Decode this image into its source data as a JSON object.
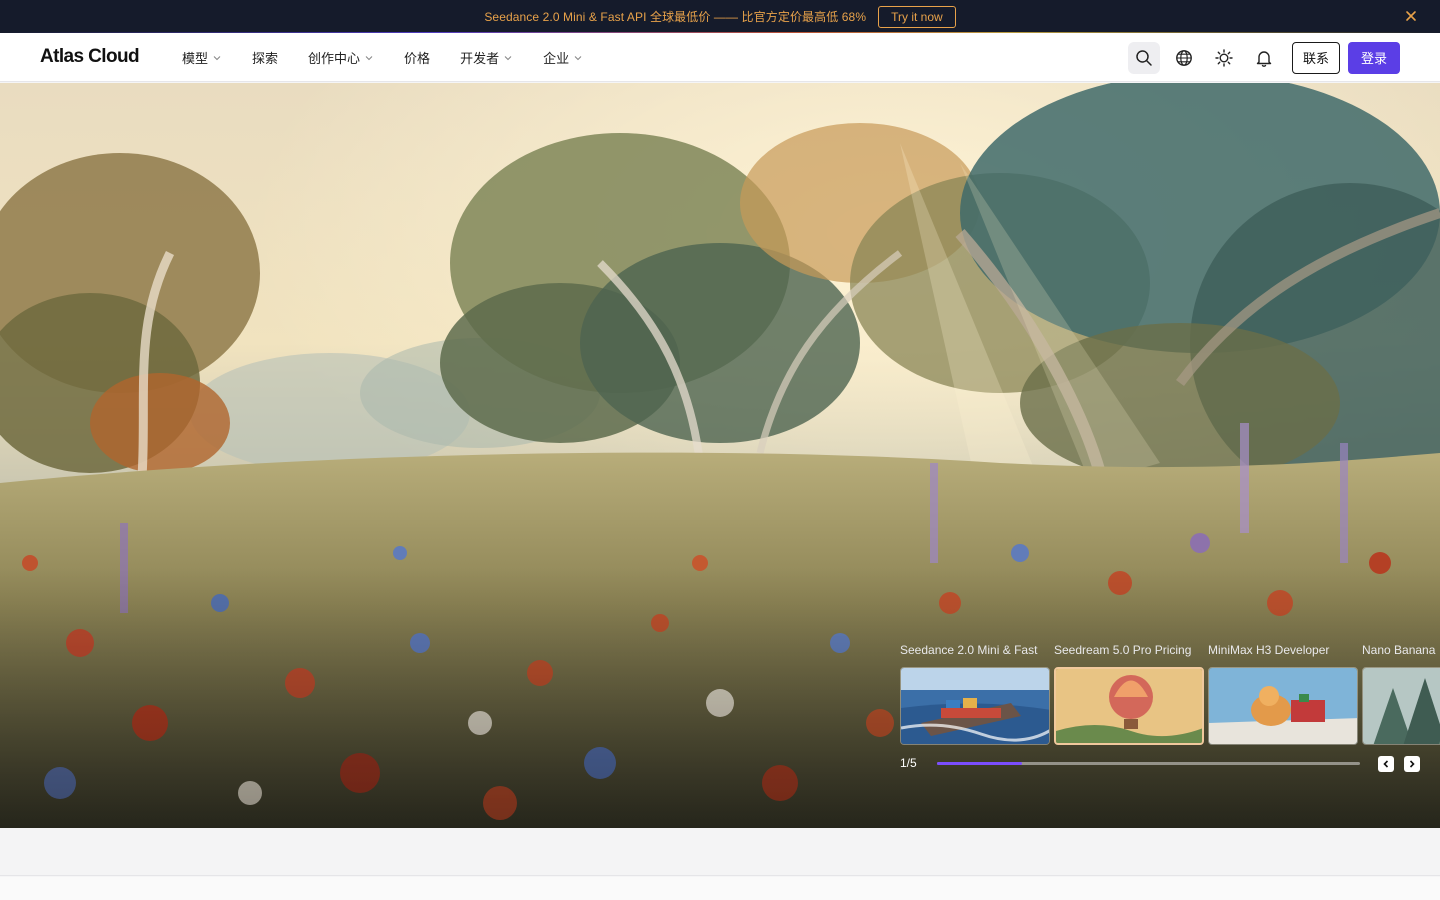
{
  "announcement": {
    "text": "Seedance 2.0 Mini & Fast API 全球最低价 —— 比官方定价最高低 68%",
    "cta_label": "Try it now",
    "accent_color": "#e8a24a",
    "close_icon": "close-icon"
  },
  "nav": {
    "logo": "Atlas Cloud",
    "menu": [
      {
        "label": "模型",
        "has_dropdown": true
      },
      {
        "label": "探索",
        "has_dropdown": false
      },
      {
        "label": "创作中心",
        "has_dropdown": true
      },
      {
        "label": "价格",
        "has_dropdown": false
      },
      {
        "label": "开发者",
        "has_dropdown": true
      },
      {
        "label": "企业",
        "has_dropdown": true
      }
    ],
    "icons": [
      "search-icon",
      "globe-icon",
      "sun-icon",
      "bell-icon"
    ],
    "contact_label": "联系",
    "login_label": "登录",
    "brand_color": "#5b3ee6"
  },
  "hero": {
    "slides": [
      {
        "label": "Seedance 2.0 Mini & Fast",
        "thumb": "container-ship"
      },
      {
        "label": "Seedream 5.0 Pro Pricing",
        "thumb": "hot-air-balloon"
      },
      {
        "label": "MiniMax H3 Developer",
        "thumb": "hamster-cart"
      },
      {
        "label": "Nano Banana",
        "thumb": "misty-forest"
      }
    ],
    "counter": "1/5",
    "progress": 0.2,
    "prev_icon": "chevron-left-icon",
    "next_icon": "chevron-right-icon"
  }
}
